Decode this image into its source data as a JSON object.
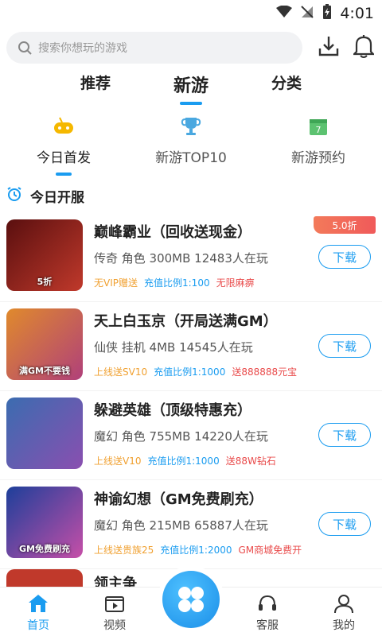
{
  "status": {
    "time": "4:01"
  },
  "search": {
    "placeholder": "搜索你想玩的游戏"
  },
  "main_tabs": [
    {
      "label": "推荐"
    },
    {
      "label": "新游",
      "active": true
    },
    {
      "label": "分类"
    }
  ],
  "sub_tabs": [
    {
      "label": "今日首发",
      "icon": "gamepad-icon",
      "active": true
    },
    {
      "label": "新游TOP10",
      "icon": "trophy-icon"
    },
    {
      "label": "新游预约",
      "icon": "calendar-icon"
    }
  ],
  "section": {
    "title": "今日开服"
  },
  "games": [
    {
      "name": "巅峰霸业（回收送现金）",
      "meta": "传奇 角色 300MB 12483人在玩",
      "tags": [
        "无VIP赠送",
        "充值比例1:100",
        "无限麻痹"
      ],
      "discount": "5.0折",
      "button": "下载",
      "thumb_text": "5折",
      "thumb_colors": [
        "#5a0f0f",
        "#c0392b"
      ]
    },
    {
      "name": "天上白玉京（开局送满GM）",
      "meta": "仙侠 挂机 4MB 14545人在玩",
      "tags": [
        "上线送SV10",
        "充值比例1:1000",
        "送888888元宝"
      ],
      "button": "下载",
      "thumb_text": "满GM不要钱",
      "thumb_colors": [
        "#e08a2c",
        "#b0407a"
      ]
    },
    {
      "name": "躲避英雄（顶级特惠充）",
      "meta": "魔幻 角色 755MB 14220人在玩",
      "tags": [
        "上线送V10",
        "充值比例1:1000",
        "送88W钻石"
      ],
      "button": "下载",
      "thumb_text": "",
      "thumb_colors": [
        "#3b6cb0",
        "#8a4fb0"
      ]
    },
    {
      "name": "神谕幻想（GM免费刷充）",
      "meta": "魔幻 角色 215MB 65887人在玩",
      "tags": [
        "上线送贵族25",
        "充值比例1:2000",
        "GM商城免费开"
      ],
      "button": "下载",
      "thumb_text": "GM免费刷充",
      "thumb_colors": [
        "#1d3f9a",
        "#c64fa8"
      ]
    }
  ],
  "partial_game": {
    "name": "领主争"
  },
  "bottom_nav": [
    {
      "label": "首页",
      "icon": "home-icon",
      "active": true
    },
    {
      "label": "视频",
      "icon": "video-icon"
    },
    {
      "label": "",
      "icon": "apps-icon"
    },
    {
      "label": "客服",
      "icon": "headset-icon"
    },
    {
      "label": "我的",
      "icon": "user-icon"
    }
  ],
  "colors": {
    "accent": "#1a9cf0",
    "tag_orange": "#f0a030",
    "tag_red": "#e94b4b"
  }
}
